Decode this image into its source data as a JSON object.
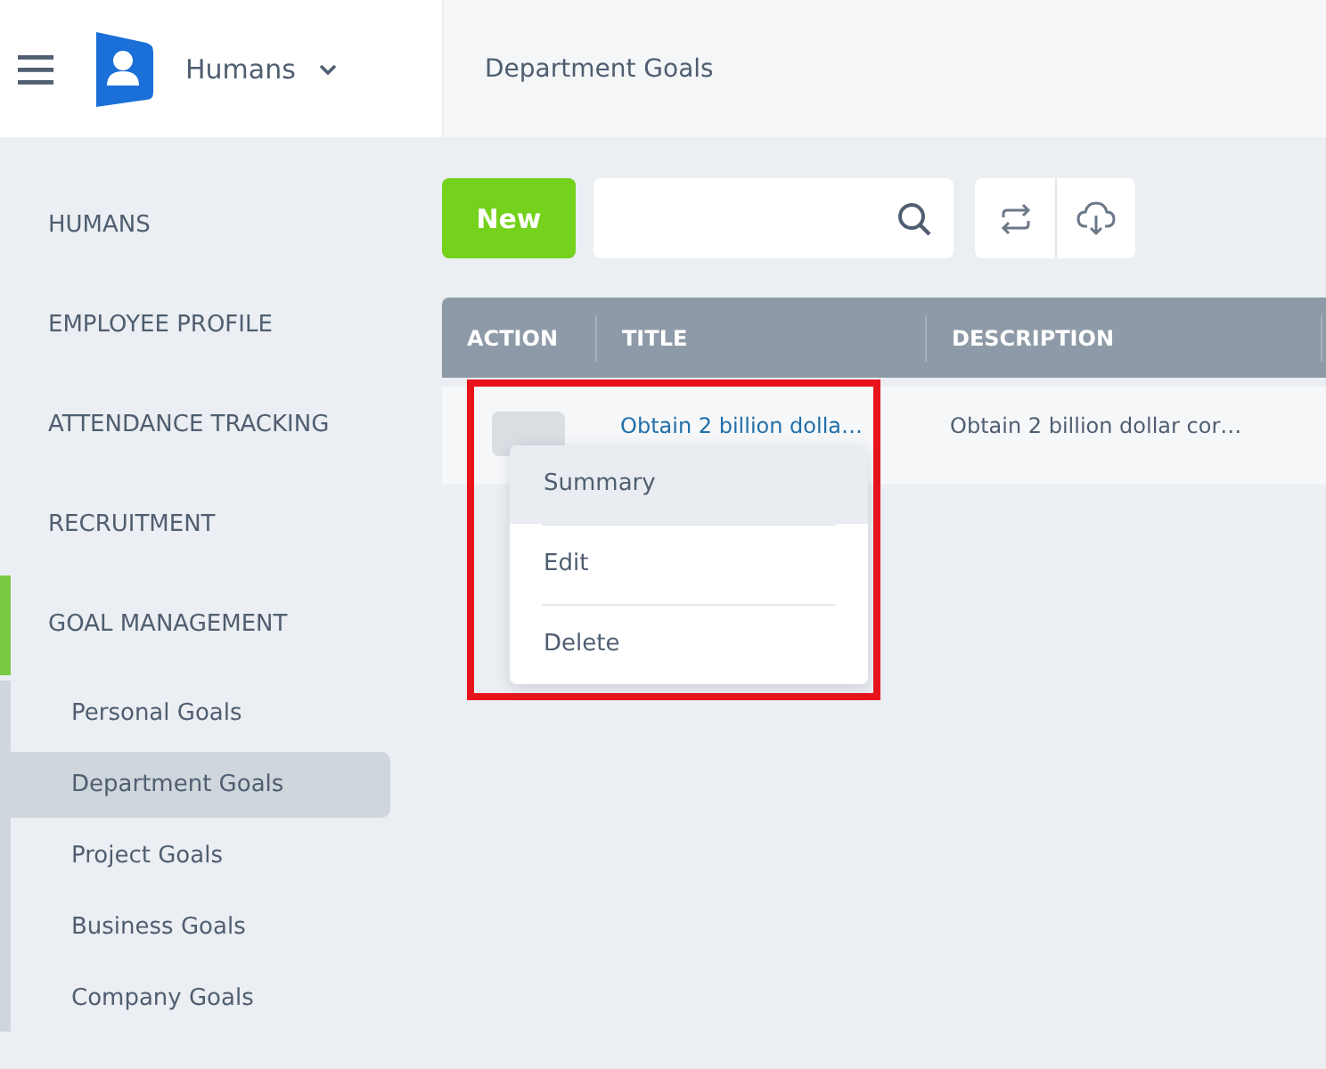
{
  "app": {
    "name": "Humans"
  },
  "breadcrumb": "Department Goals",
  "sidebar": {
    "items": [
      {
        "label": "HUMANS",
        "selected": false
      },
      {
        "label": "EMPLOYEE PROFILE",
        "selected": false
      },
      {
        "label": "ATTENDANCE TRACKING",
        "selected": false
      },
      {
        "label": "RECRUITMENT",
        "selected": false
      },
      {
        "label": "GOAL MANAGEMENT",
        "selected": true,
        "children": [
          {
            "label": "Personal Goals",
            "selected": false
          },
          {
            "label": "Department Goals",
            "selected": true
          },
          {
            "label": "Project Goals",
            "selected": false
          },
          {
            "label": "Business Goals",
            "selected": false
          },
          {
            "label": "Company Goals",
            "selected": false
          }
        ]
      }
    ]
  },
  "toolbar": {
    "new_button": "New"
  },
  "table": {
    "columns": [
      "ACTION",
      "TITLE",
      "DESCRIPTION"
    ],
    "rows": [
      {
        "title": "Obtain 2 billion dolla…",
        "description": "Obtain 2 billion dollar cor…"
      }
    ]
  },
  "action_menu": {
    "items": [
      {
        "label": "Summary",
        "highlighted": true
      },
      {
        "label": "Edit",
        "highlighted": false
      },
      {
        "label": "Delete",
        "highlighted": false
      }
    ]
  }
}
